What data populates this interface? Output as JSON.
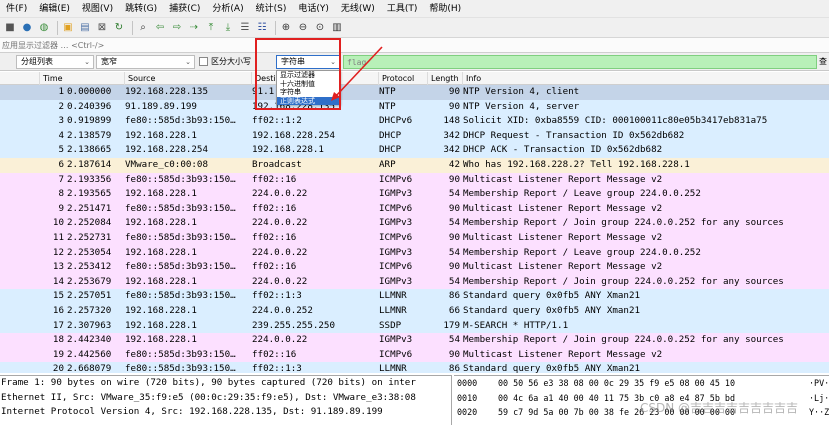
{
  "menu": [
    "件(F)",
    "编辑(E)",
    "视图(V)",
    "跳转(G)",
    "捕获(C)",
    "分析(A)",
    "统计(S)",
    "电话(Y)",
    "无线(W)",
    "工具(T)",
    "帮助(H)"
  ],
  "toolbar": [
    {
      "icon": "stop-square-icon",
      "glyph": "■",
      "color": "#555555"
    },
    {
      "icon": "restart-icon",
      "glyph": "●",
      "color": "#2a6fb5"
    },
    {
      "icon": "options-icon",
      "glyph": "◍",
      "color": "#3a8d3a"
    },
    {
      "icon": "open-file-icon",
      "glyph": "▣",
      "color": "#e0a020"
    },
    {
      "icon": "save-file-icon",
      "glyph": "▤",
      "color": "#4a6fa5"
    },
    {
      "icon": "close-file-icon",
      "glyph": "⊠",
      "color": "#4a4a4a"
    },
    {
      "icon": "reload-icon",
      "glyph": "↻",
      "color": "#2a7a2a"
    },
    {
      "icon": "find-icon",
      "glyph": "⌕",
      "color": "#333333"
    },
    {
      "icon": "go-back-icon",
      "glyph": "⇦",
      "color": "#3a8d3a"
    },
    {
      "icon": "go-forward-icon",
      "glyph": "⇨",
      "color": "#3a8d3a"
    },
    {
      "icon": "go-to-packet-icon",
      "glyph": "⇢",
      "color": "#3a8d3a"
    },
    {
      "icon": "first-packet-icon",
      "glyph": "⤒",
      "color": "#3a8d3a"
    },
    {
      "icon": "last-packet-icon",
      "glyph": "⤓",
      "color": "#3a8d3a"
    },
    {
      "icon": "autoscroll-icon",
      "glyph": "☰",
      "color": "#555555"
    },
    {
      "icon": "colorize-icon",
      "glyph": "☷",
      "color": "#3050a0"
    },
    {
      "icon": "zoom-in-icon",
      "glyph": "⊕",
      "color": "#333333"
    },
    {
      "icon": "zoom-out-icon",
      "glyph": "⊖",
      "color": "#333333"
    },
    {
      "icon": "zoom-reset-icon",
      "glyph": "⊙",
      "color": "#333333"
    },
    {
      "icon": "resize-columns-icon",
      "glyph": "▥",
      "color": "#333333"
    }
  ],
  "filter": {
    "placeholder": "应用显示过滤器 … <Ctrl-/>"
  },
  "search": {
    "scope": "分组列表",
    "charset": "宽窄",
    "case_label": "区分大小写",
    "type": "字符串",
    "value": "flag",
    "find_label": "查"
  },
  "dropdown_options": [
    "显示过滤器",
    "十六进制值",
    "字符串",
    "正则表达式"
  ],
  "columns": [
    "",
    "Time",
    "Source",
    "Destination",
    "Protocol",
    "Length",
    "Info"
  ],
  "colors": {
    "selected": "#c4d4e8",
    "ntp": "#daeeff",
    "dhcp": "#daeeff",
    "arp": "#faf0d7",
    "icmpv6": "#fce0ff",
    "igmp": "#fce0ff",
    "udp": "#daeeff",
    "highlight": "#e02020"
  },
  "packets": [
    {
      "no": "1",
      "time": "0.000000",
      "src": "192.168.228.135",
      "dst": "91.1",
      "proto": "NTP",
      "len": "90",
      "info": "NTP Version 4, client",
      "kind": "selected"
    },
    {
      "no": "2",
      "time": "0.240396",
      "src": "91.189.89.199",
      "dst": "192.168.228.135",
      "proto": "NTP",
      "len": "90",
      "info": "NTP Version 4, server",
      "kind": "ntp"
    },
    {
      "no": "3",
      "time": "0.919899",
      "src": "fe80::585d:3b93:150…",
      "dst": "ff02::1:2",
      "proto": "DHCPv6",
      "len": "148",
      "info": "Solicit XID: 0xba8559 CID: 000100011c80e05b3417eb831a75",
      "kind": "dhcp"
    },
    {
      "no": "4",
      "time": "2.138579",
      "src": "192.168.228.1",
      "dst": "192.168.228.254",
      "proto": "DHCP",
      "len": "342",
      "info": "DHCP Request  - Transaction ID 0x562db682",
      "kind": "dhcp"
    },
    {
      "no": "5",
      "time": "2.138665",
      "src": "192.168.228.254",
      "dst": "192.168.228.1",
      "proto": "DHCP",
      "len": "342",
      "info": "DHCP ACK      - Transaction ID 0x562db682",
      "kind": "dhcp"
    },
    {
      "no": "6",
      "time": "2.187614",
      "src": "VMware_c0:00:08",
      "dst": "Broadcast",
      "proto": "ARP",
      "len": "42",
      "info": "Who has 192.168.228.2? Tell 192.168.228.1",
      "kind": "arp"
    },
    {
      "no": "7",
      "time": "2.193356",
      "src": "fe80::585d:3b93:150…",
      "dst": "ff02::16",
      "proto": "ICMPv6",
      "len": "90",
      "info": "Multicast Listener Report Message v2",
      "kind": "icmpv6"
    },
    {
      "no": "8",
      "time": "2.193565",
      "src": "192.168.228.1",
      "dst": "224.0.0.22",
      "proto": "IGMPv3",
      "len": "54",
      "info": "Membership Report / Leave group 224.0.0.252",
      "kind": "igmp"
    },
    {
      "no": "9",
      "time": "2.251471",
      "src": "fe80::585d:3b93:150…",
      "dst": "ff02::16",
      "proto": "ICMPv6",
      "len": "90",
      "info": "Multicast Listener Report Message v2",
      "kind": "icmpv6"
    },
    {
      "no": "10",
      "time": "2.252084",
      "src": "192.168.228.1",
      "dst": "224.0.0.22",
      "proto": "IGMPv3",
      "len": "54",
      "info": "Membership Report / Join group 224.0.0.252 for any sources",
      "kind": "igmp"
    },
    {
      "no": "11",
      "time": "2.252731",
      "src": "fe80::585d:3b93:150…",
      "dst": "ff02::16",
      "proto": "ICMPv6",
      "len": "90",
      "info": "Multicast Listener Report Message v2",
      "kind": "icmpv6"
    },
    {
      "no": "12",
      "time": "2.253054",
      "src": "192.168.228.1",
      "dst": "224.0.0.22",
      "proto": "IGMPv3",
      "len": "54",
      "info": "Membership Report / Leave group 224.0.0.252",
      "kind": "igmp"
    },
    {
      "no": "13",
      "time": "2.253412",
      "src": "fe80::585d:3b93:150…",
      "dst": "ff02::16",
      "proto": "ICMPv6",
      "len": "90",
      "info": "Multicast Listener Report Message v2",
      "kind": "icmpv6"
    },
    {
      "no": "14",
      "time": "2.253679",
      "src": "192.168.228.1",
      "dst": "224.0.0.22",
      "proto": "IGMPv3",
      "len": "54",
      "info": "Membership Report / Join group 224.0.0.252 for any sources",
      "kind": "igmp"
    },
    {
      "no": "15",
      "time": "2.257051",
      "src": "fe80::585d:3b93:150…",
      "dst": "ff02::1:3",
      "proto": "LLMNR",
      "len": "86",
      "info": "Standard query 0x0fb5 ANY Xman21",
      "kind": "udp"
    },
    {
      "no": "16",
      "time": "2.257320",
      "src": "192.168.228.1",
      "dst": "224.0.0.252",
      "proto": "LLMNR",
      "len": "66",
      "info": "Standard query 0x0fb5 ANY Xman21",
      "kind": "udp"
    },
    {
      "no": "17",
      "time": "2.307963",
      "src": "192.168.228.1",
      "dst": "239.255.255.250",
      "proto": "SSDP",
      "len": "179",
      "info": "M-SEARCH * HTTP/1.1",
      "kind": "udp"
    },
    {
      "no": "18",
      "time": "2.442340",
      "src": "192.168.228.1",
      "dst": "224.0.0.22",
      "proto": "IGMPv3",
      "len": "54",
      "info": "Membership Report / Join group 224.0.0.252 for any sources",
      "kind": "igmp"
    },
    {
      "no": "19",
      "time": "2.442560",
      "src": "fe80::585d:3b93:150…",
      "dst": "ff02::16",
      "proto": "ICMPv6",
      "len": "90",
      "info": "Multicast Listener Report Message v2",
      "kind": "icmpv6"
    },
    {
      "no": "20",
      "time": "2.668079",
      "src": "fe80::585d:3b93:150…",
      "dst": "ff02::1:3",
      "proto": "LLMNR",
      "len": "86",
      "info": "Standard query 0x0fb5 ANY Xman21",
      "kind": "udp"
    }
  ],
  "details": [
    "Frame 1: 90 bytes on wire (720 bits), 90 bytes captured (720 bits) on inter",
    "Ethernet II, Src: VMware_35:f9:e5 (00:0c:29:35:f9:e5), Dst: VMware_e3:38:08",
    "Internet Protocol Version 4, Src: 192.168.228.135, Dst: 91.189.89.199"
  ],
  "hex": [
    {
      "offset": "0000",
      "bytes": "00 50 56 e3 38 08 00 0c  29 35 f9 e5 08 00 45 10",
      "ascii": "·PV·"
    },
    {
      "offset": "0010",
      "bytes": "00 4c 6a a1 40 00 40 11  75 3b c0 a8 e4 87 5b bd",
      "ascii": "·Lj·"
    },
    {
      "offset": "0020",
      "bytes": "59 c7 9d 5a 00 7b 00 38  fe 26 23 00 00 00 00 00",
      "ascii": "Y··Z"
    }
  ],
  "watermark": "CSDN @吉吉吉吉吉吉吉吉吉"
}
